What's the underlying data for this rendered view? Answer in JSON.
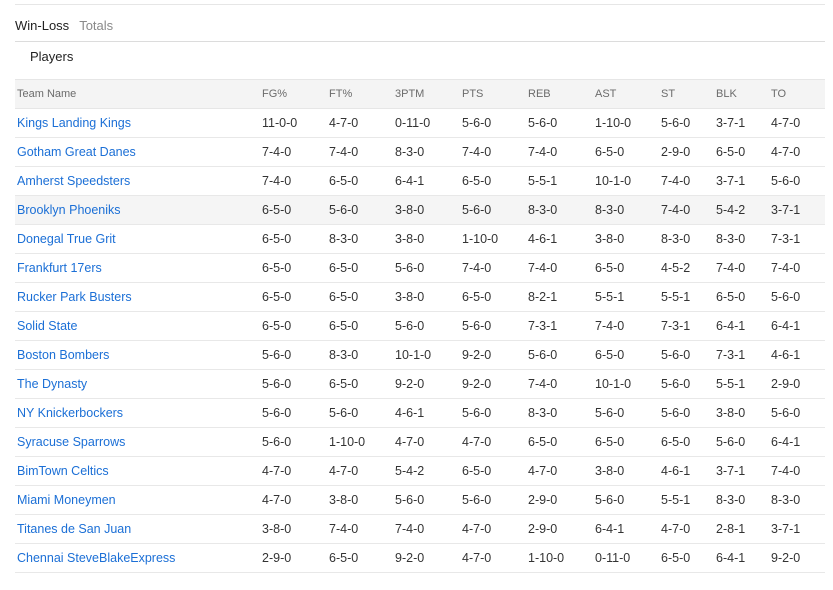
{
  "tabs": [
    {
      "label": "Win-Loss",
      "active": true
    },
    {
      "label": "Totals",
      "active": false
    }
  ],
  "subtab": "Players",
  "columns": [
    "Team Name",
    "FG%",
    "FT%",
    "3PTM",
    "PTS",
    "REB",
    "AST",
    "ST",
    "BLK",
    "TO"
  ],
  "rows": [
    {
      "team": "Kings Landing Kings",
      "stats": [
        "11-0-0",
        "4-7-0",
        "0-11-0",
        "5-6-0",
        "5-6-0",
        "1-10-0",
        "5-6-0",
        "3-7-1",
        "4-7-0"
      ]
    },
    {
      "team": "Gotham Great Danes",
      "stats": [
        "7-4-0",
        "7-4-0",
        "8-3-0",
        "7-4-0",
        "7-4-0",
        "6-5-0",
        "2-9-0",
        "6-5-0",
        "4-7-0"
      ]
    },
    {
      "team": "Amherst Speedsters",
      "stats": [
        "7-4-0",
        "6-5-0",
        "6-4-1",
        "6-5-0",
        "5-5-1",
        "10-1-0",
        "7-4-0",
        "3-7-1",
        "5-6-0"
      ]
    },
    {
      "team": "Brooklyn Phoeniks",
      "stats": [
        "6-5-0",
        "5-6-0",
        "3-8-0",
        "5-6-0",
        "8-3-0",
        "8-3-0",
        "7-4-0",
        "5-4-2",
        "3-7-1"
      ],
      "highlighted": true
    },
    {
      "team": "Donegal True Grit",
      "stats": [
        "6-5-0",
        "8-3-0",
        "3-8-0",
        "1-10-0",
        "4-6-1",
        "3-8-0",
        "8-3-0",
        "8-3-0",
        "7-3-1"
      ]
    },
    {
      "team": "Frankfurt 17ers",
      "stats": [
        "6-5-0",
        "6-5-0",
        "5-6-0",
        "7-4-0",
        "7-4-0",
        "6-5-0",
        "4-5-2",
        "7-4-0",
        "7-4-0"
      ]
    },
    {
      "team": "Rucker Park Busters",
      "stats": [
        "6-5-0",
        "6-5-0",
        "3-8-0",
        "6-5-0",
        "8-2-1",
        "5-5-1",
        "5-5-1",
        "6-5-0",
        "5-6-0"
      ]
    },
    {
      "team": "Solid State",
      "stats": [
        "6-5-0",
        "6-5-0",
        "5-6-0",
        "5-6-0",
        "7-3-1",
        "7-4-0",
        "7-3-1",
        "6-4-1",
        "6-4-1"
      ]
    },
    {
      "team": "Boston Bombers",
      "stats": [
        "5-6-0",
        "8-3-0",
        "10-1-0",
        "9-2-0",
        "5-6-0",
        "6-5-0",
        "5-6-0",
        "7-3-1",
        "4-6-1"
      ]
    },
    {
      "team": "The Dynasty",
      "stats": [
        "5-6-0",
        "6-5-0",
        "9-2-0",
        "9-2-0",
        "7-4-0",
        "10-1-0",
        "5-6-0",
        "5-5-1",
        "2-9-0"
      ]
    },
    {
      "team": "NY Knickerbockers",
      "stats": [
        "5-6-0",
        "5-6-0",
        "4-6-1",
        "5-6-0",
        "8-3-0",
        "5-6-0",
        "5-6-0",
        "3-8-0",
        "5-6-0"
      ]
    },
    {
      "team": "Syracuse Sparrows",
      "stats": [
        "5-6-0",
        "1-10-0",
        "4-7-0",
        "4-7-0",
        "6-5-0",
        "6-5-0",
        "6-5-0",
        "5-6-0",
        "6-4-1"
      ]
    },
    {
      "team": "BimTown Celtics",
      "stats": [
        "4-7-0",
        "4-7-0",
        "5-4-2",
        "6-5-0",
        "4-7-0",
        "3-8-0",
        "4-6-1",
        "3-7-1",
        "7-4-0"
      ]
    },
    {
      "team": "Miami Moneymen",
      "stats": [
        "4-7-0",
        "3-8-0",
        "5-6-0",
        "5-6-0",
        "2-9-0",
        "5-6-0",
        "5-5-1",
        "8-3-0",
        "8-3-0"
      ]
    },
    {
      "team": "Titanes de San Juan",
      "stats": [
        "3-8-0",
        "7-4-0",
        "7-4-0",
        "4-7-0",
        "2-9-0",
        "6-4-1",
        "4-7-0",
        "2-8-1",
        "3-7-1"
      ]
    },
    {
      "team": "Chennai SteveBlakeExpress",
      "stats": [
        "2-9-0",
        "6-5-0",
        "9-2-0",
        "4-7-0",
        "1-10-0",
        "0-11-0",
        "6-5-0",
        "6-4-1",
        "9-2-0"
      ]
    }
  ]
}
